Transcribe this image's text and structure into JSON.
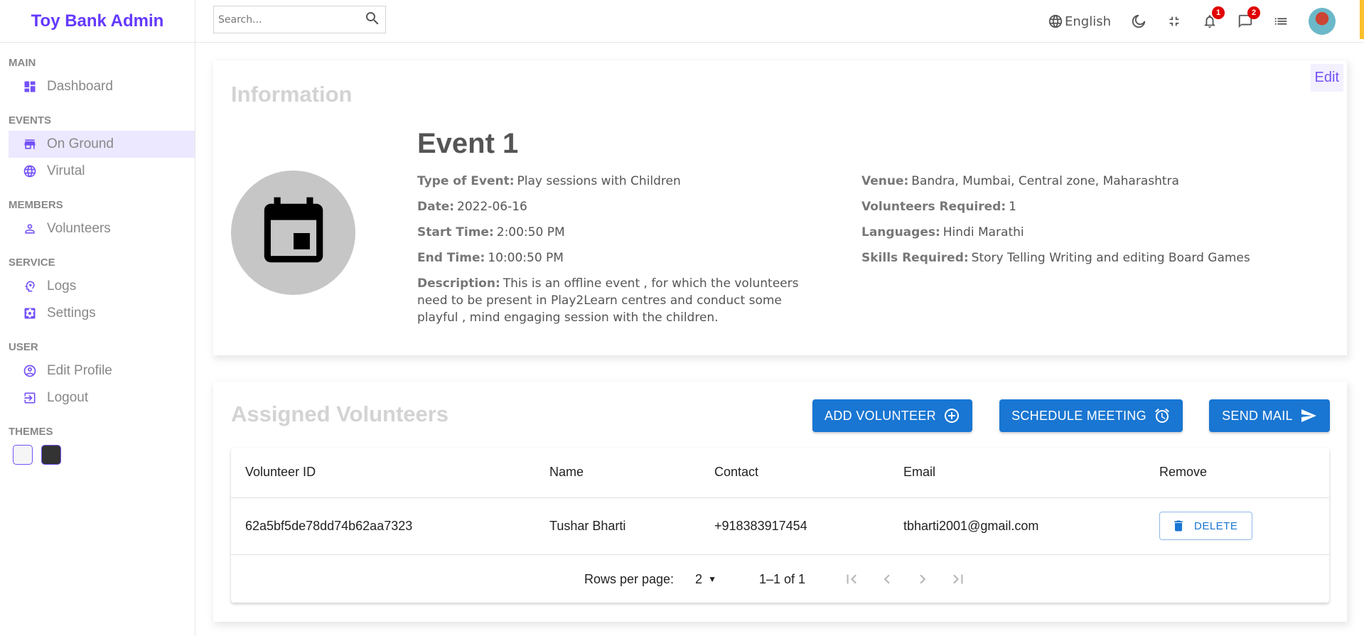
{
  "app": {
    "title": "Toy Bank Admin"
  },
  "search": {
    "placeholder": "Search..."
  },
  "topbar": {
    "language": "English",
    "notifications_count": "1",
    "messages_count": "2"
  },
  "sidebar": {
    "sections": [
      {
        "title": "MAIN",
        "items": [
          {
            "label": "Dashboard",
            "icon": "dashboard-icon"
          }
        ]
      },
      {
        "title": "EVENTS",
        "items": [
          {
            "label": "On Ground",
            "icon": "store-icon",
            "active": true
          },
          {
            "label": "Virutal",
            "icon": "globe-icon"
          }
        ]
      },
      {
        "title": "MEMBERS",
        "items": [
          {
            "label": "Volunteers",
            "icon": "person-icon"
          }
        ]
      },
      {
        "title": "SERVICE",
        "items": [
          {
            "label": "Logs",
            "icon": "psychology-icon"
          },
          {
            "label": "Settings",
            "icon": "settings-icon"
          }
        ]
      },
      {
        "title": "USER",
        "items": [
          {
            "label": "Edit Profile",
            "icon": "account-circle-icon"
          },
          {
            "label": "Logout",
            "icon": "logout-icon"
          }
        ]
      },
      {
        "title": "THEMES",
        "items": []
      }
    ]
  },
  "info": {
    "title": "Information",
    "edit_label": "Edit",
    "event_name": "Event 1",
    "left": [
      {
        "key": "Type of Event:",
        "value": "Play sessions with Children"
      },
      {
        "key": "Date:",
        "value": "2022-06-16"
      },
      {
        "key": "Start Time:",
        "value": "2:00:50 PM"
      },
      {
        "key": "End Time:",
        "value": "10:00:50 PM"
      },
      {
        "key": "Description:",
        "value": "This is an offline event , for which the volunteers need to be present in Play2Learn centres and conduct some playful , mind engaging session with the children."
      }
    ],
    "right": [
      {
        "key": "Venue:",
        "value": "Bandra, Mumbai, Central zone, Maharashtra"
      },
      {
        "key": "Volunteers Required:",
        "value": "1"
      },
      {
        "key": "Languages:",
        "value": "Hindi Marathi"
      },
      {
        "key": "Skills Required:",
        "value": "Story Telling Writing and editing Board Games"
      }
    ]
  },
  "volunteers": {
    "title": "Assigned Volunteers",
    "add_label": "ADD VOLUNTEER",
    "schedule_label": "SCHEDULE MEETING",
    "mail_label": "SEND MAIL",
    "columns": [
      "Volunteer ID",
      "Name",
      "Contact",
      "Email",
      "Remove"
    ],
    "rows": [
      {
        "id": "62a5bf5de78dd74b62aa7323",
        "name": "Tushar Bharti",
        "contact": "+918383917454",
        "email": "tbharti2001@gmail.com",
        "remove_label": "DELETE"
      }
    ],
    "pagination": {
      "rows_per_page_label": "Rows per page:",
      "rows_per_page": "2",
      "range": "1–1 of 1"
    }
  }
}
